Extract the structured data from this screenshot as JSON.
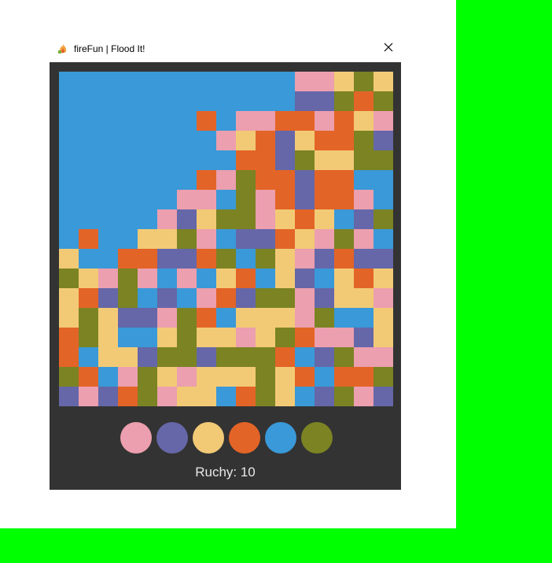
{
  "window": {
    "title": "fireFun | Flood It!",
    "icon": "fire-app-icon",
    "close_icon": "close-icon"
  },
  "colors": {
    "pink": "#ec9fae",
    "indigo": "#6567a8",
    "yellow": "#f2ca76",
    "orange": "#e36427",
    "blue": "#3a99d8",
    "olive": "#7b8323",
    "background": "#333333"
  },
  "palette": [
    "pink",
    "indigo",
    "yellow",
    "orange",
    "blue",
    "olive"
  ],
  "board": {
    "size": 17,
    "rows": [
      [
        "blue",
        "blue",
        "blue",
        "blue",
        "blue",
        "blue",
        "blue",
        "blue",
        "blue",
        "blue",
        "blue",
        "blue",
        "pink",
        "pink",
        "yellow",
        "olive",
        "yellow"
      ],
      [
        "blue",
        "blue",
        "blue",
        "blue",
        "blue",
        "blue",
        "blue",
        "blue",
        "blue",
        "blue",
        "blue",
        "blue",
        "indigo",
        "indigo",
        "olive",
        "orange",
        "olive"
      ],
      [
        "blue",
        "blue",
        "blue",
        "blue",
        "blue",
        "blue",
        "blue",
        "orange",
        "blue",
        "pink",
        "pink",
        "orange",
        "orange",
        "pink",
        "orange",
        "yellow",
        "pink"
      ],
      [
        "blue",
        "blue",
        "blue",
        "blue",
        "blue",
        "blue",
        "blue",
        "blue",
        "pink",
        "yellow",
        "orange",
        "indigo",
        "yellow",
        "orange",
        "orange",
        "olive",
        "indigo"
      ],
      [
        "blue",
        "blue",
        "blue",
        "blue",
        "blue",
        "blue",
        "blue",
        "blue",
        "blue",
        "orange",
        "orange",
        "indigo",
        "olive",
        "yellow",
        "yellow",
        "olive",
        "olive"
      ],
      [
        "blue",
        "blue",
        "blue",
        "blue",
        "blue",
        "blue",
        "blue",
        "orange",
        "pink",
        "olive",
        "orange",
        "orange",
        "indigo",
        "orange",
        "orange",
        "blue",
        "blue"
      ],
      [
        "blue",
        "blue",
        "blue",
        "blue",
        "blue",
        "blue",
        "pink",
        "pink",
        "blue",
        "olive",
        "pink",
        "orange",
        "indigo",
        "orange",
        "orange",
        "pink",
        "blue"
      ],
      [
        "blue",
        "blue",
        "blue",
        "blue",
        "blue",
        "pink",
        "indigo",
        "yellow",
        "olive",
        "olive",
        "pink",
        "yellow",
        "orange",
        "yellow",
        "blue",
        "indigo",
        "olive"
      ],
      [
        "blue",
        "orange",
        "blue",
        "blue",
        "yellow",
        "yellow",
        "olive",
        "pink",
        "blue",
        "indigo",
        "indigo",
        "orange",
        "yellow",
        "pink",
        "olive",
        "pink",
        "blue"
      ],
      [
        "yellow",
        "blue",
        "blue",
        "orange",
        "orange",
        "indigo",
        "indigo",
        "orange",
        "olive",
        "blue",
        "olive",
        "yellow",
        "pink",
        "indigo",
        "orange",
        "indigo",
        "indigo"
      ],
      [
        "olive",
        "yellow",
        "pink",
        "olive",
        "pink",
        "blue",
        "pink",
        "blue",
        "yellow",
        "orange",
        "blue",
        "yellow",
        "indigo",
        "blue",
        "yellow",
        "orange",
        "yellow"
      ],
      [
        "yellow",
        "orange",
        "indigo",
        "olive",
        "blue",
        "indigo",
        "blue",
        "pink",
        "orange",
        "indigo",
        "olive",
        "olive",
        "pink",
        "indigo",
        "yellow",
        "yellow",
        "pink"
      ],
      [
        "yellow",
        "olive",
        "yellow",
        "indigo",
        "indigo",
        "pink",
        "olive",
        "orange",
        "blue",
        "yellow",
        "yellow",
        "yellow",
        "pink",
        "olive",
        "blue",
        "blue",
        "yellow"
      ],
      [
        "orange",
        "olive",
        "yellow",
        "blue",
        "blue",
        "yellow",
        "olive",
        "yellow",
        "yellow",
        "pink",
        "yellow",
        "olive",
        "orange",
        "pink",
        "pink",
        "indigo",
        "yellow"
      ],
      [
        "orange",
        "blue",
        "yellow",
        "yellow",
        "indigo",
        "olive",
        "olive",
        "indigo",
        "olive",
        "olive",
        "olive",
        "orange",
        "blue",
        "indigo",
        "olive",
        "pink",
        "pink"
      ],
      [
        "olive",
        "orange",
        "blue",
        "pink",
        "olive",
        "yellow",
        "pink",
        "yellow",
        "yellow",
        "yellow",
        "olive",
        "yellow",
        "orange",
        "blue",
        "orange",
        "orange",
        "olive"
      ],
      [
        "indigo",
        "pink",
        "indigo",
        "orange",
        "olive",
        "pink",
        "yellow",
        "yellow",
        "blue",
        "orange",
        "olive",
        "yellow",
        "blue",
        "indigo",
        "olive",
        "pink",
        "indigo"
      ]
    ]
  },
  "status": {
    "moves_label": "Ruchy: 10"
  }
}
